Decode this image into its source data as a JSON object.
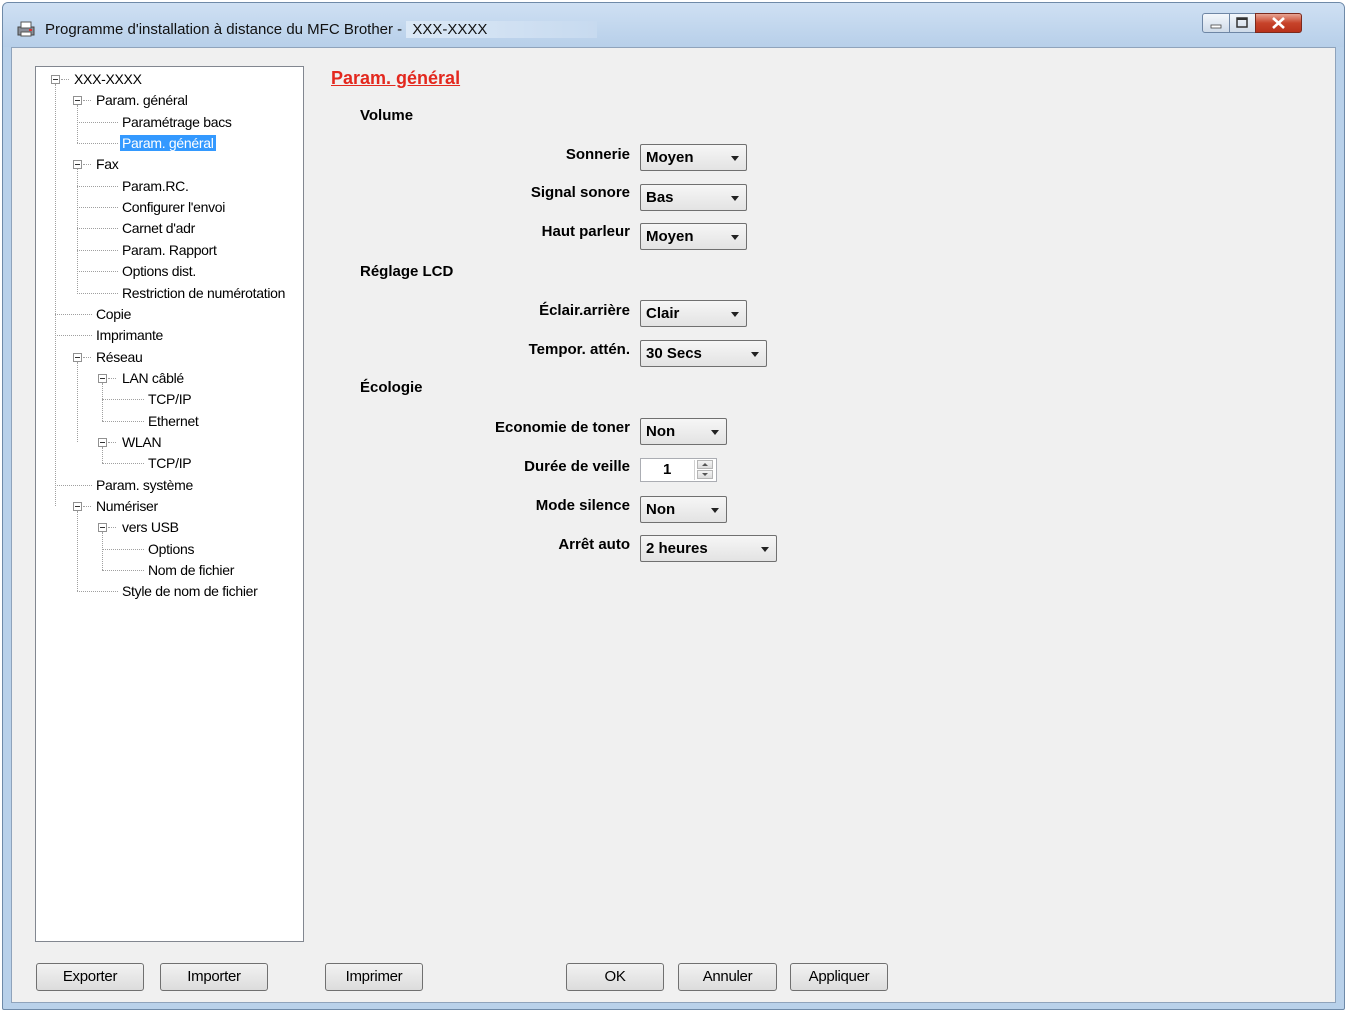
{
  "window": {
    "title_prefix": "Programme d'installation à distance du MFC Brother -",
    "title_device": "XXX-XXXX",
    "controls": {
      "minimize": "minimize-icon",
      "maximize": "maximize-icon",
      "close": "close-icon"
    }
  },
  "tree": {
    "items": [
      {
        "label": "XXX-XXXX",
        "level": 0,
        "expandable": true
      },
      {
        "label": "Param. général",
        "level": 1,
        "expandable": true
      },
      {
        "label": "Paramétrage bacs",
        "level": 2,
        "expandable": false
      },
      {
        "label": "Param. général",
        "level": 2,
        "expandable": false,
        "selected": true
      },
      {
        "label": "Fax",
        "level": 1,
        "expandable": true
      },
      {
        "label": "Param.RC.",
        "level": 2,
        "expandable": false
      },
      {
        "label": "Configurer l'envoi",
        "level": 2,
        "expandable": false
      },
      {
        "label": "Carnet d'adr",
        "level": 2,
        "expandable": false
      },
      {
        "label": "Param. Rapport",
        "level": 2,
        "expandable": false
      },
      {
        "label": "Options dist.",
        "level": 2,
        "expandable": false
      },
      {
        "label": "Restriction de numérotation",
        "level": 2,
        "expandable": false
      },
      {
        "label": "Copie",
        "level": 1,
        "expandable": false
      },
      {
        "label": "Imprimante",
        "level": 1,
        "expandable": false
      },
      {
        "label": "Réseau",
        "level": 1,
        "expandable": true
      },
      {
        "label": "LAN câblé",
        "level": 2,
        "expandable": true
      },
      {
        "label": "TCP/IP",
        "level": 3,
        "expandable": false
      },
      {
        "label": "Ethernet",
        "level": 3,
        "expandable": false
      },
      {
        "label": "WLAN",
        "level": 2,
        "expandable": true
      },
      {
        "label": "TCP/IP",
        "level": 3,
        "expandable": false
      },
      {
        "label": "Param. système",
        "level": 1,
        "expandable": false
      },
      {
        "label": "Numériser",
        "level": 1,
        "expandable": true
      },
      {
        "label": "vers USB",
        "level": 2,
        "expandable": true
      },
      {
        "label": "Options",
        "level": 3,
        "expandable": false
      },
      {
        "label": "Nom de fichier",
        "level": 3,
        "expandable": false
      },
      {
        "label": "Style de nom de fichier",
        "level": 2,
        "expandable": false
      }
    ]
  },
  "main": {
    "section_title": "Param. général",
    "groups": {
      "volume": "Volume",
      "lcd": "Réglage LCD",
      "ecology": "Écologie"
    },
    "fields": {
      "sonnerie": {
        "label": "Sonnerie",
        "value": "Moyen"
      },
      "signal": {
        "label": "Signal sonore",
        "value": "Bas"
      },
      "haut_parleur": {
        "label": "Haut parleur",
        "value": "Moyen"
      },
      "eclair": {
        "label": "Éclair.arrière",
        "value": "Clair"
      },
      "tempor": {
        "label": "Tempor. attén.",
        "value": "30 Secs"
      },
      "toner": {
        "label": "Economie de toner",
        "value": "Non"
      },
      "veille": {
        "label": "Durée de veille",
        "value": "1"
      },
      "silence": {
        "label": "Mode silence",
        "value": "Non"
      },
      "arret": {
        "label": "Arrêt auto",
        "value": "2 heures"
      }
    }
  },
  "buttons": {
    "exporter": "Exporter",
    "importer": "Importer",
    "imprimer": "Imprimer",
    "ok": "OK",
    "annuler": "Annuler",
    "appliquer": "Appliquer"
  }
}
